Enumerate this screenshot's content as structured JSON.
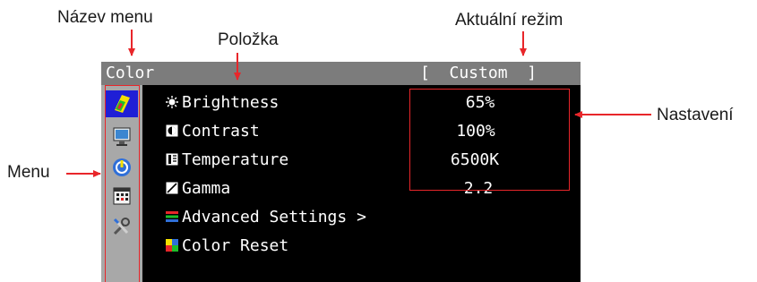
{
  "callouts": {
    "menu_name": "Název menu",
    "item": "Položka",
    "current_mode": "Aktuální režim",
    "settings": "Nastavení",
    "menu": "Menu"
  },
  "osd": {
    "title": "Color",
    "mode": "[  Custom  ]",
    "sidebar_icons": [
      "color-icon",
      "screen-icon",
      "power-icon",
      "calendar-icon",
      "tools-icon"
    ],
    "items": [
      {
        "label": "Brightness",
        "value": "65%",
        "icon": "sun-icon"
      },
      {
        "label": "Contrast",
        "value": "100%",
        "icon": "contrast-icon"
      },
      {
        "label": "Temperature",
        "value": "6500K",
        "icon": "thermometer-icon"
      },
      {
        "label": "Gamma",
        "value": "2.2",
        "icon": "gamma-icon"
      },
      {
        "label": "Advanced Settings >",
        "icon": "rgb-icon"
      },
      {
        "label": "Color Reset",
        "icon": "reset-icon"
      }
    ]
  },
  "colors": {
    "osd_bg": "#000000",
    "titlebar": "#7c7c7c",
    "sidebar": "#a8a8a8",
    "highlight": "#1f1fd6",
    "annotation": "#e8262a"
  }
}
